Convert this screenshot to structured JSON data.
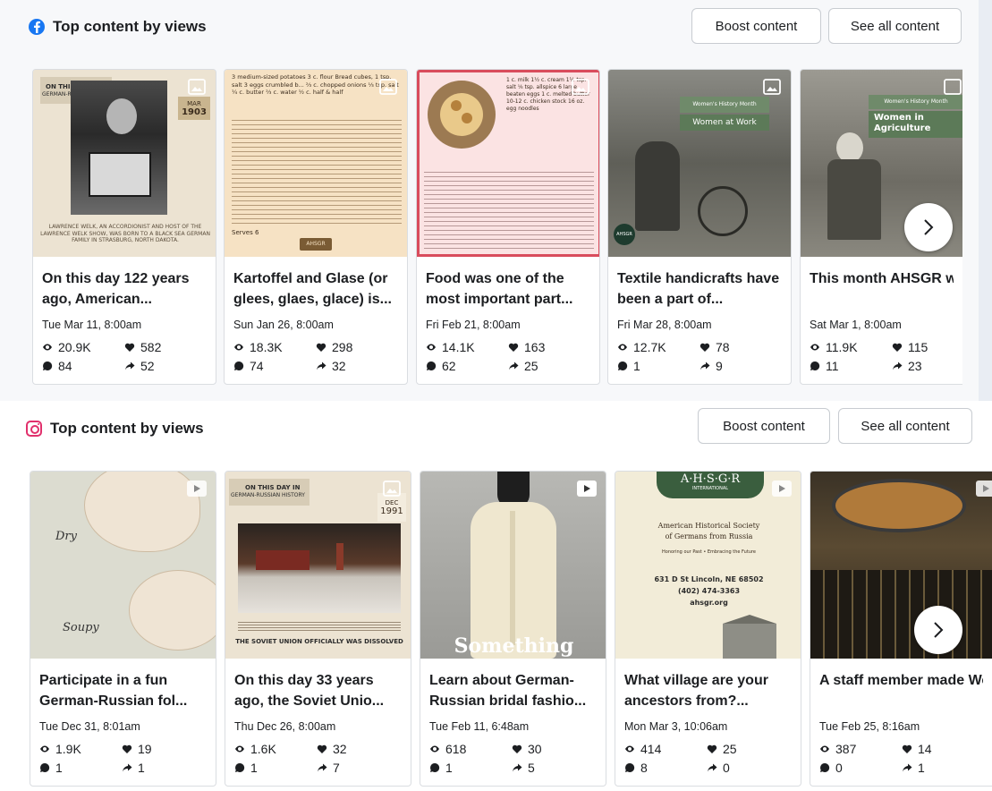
{
  "facebook": {
    "title": "Top content by views",
    "boost_label": "Boost content",
    "see_all_label": "See all content",
    "posts": [
      {
        "title": "On this day 122 years ago, American...",
        "date": "Tue Mar 11, 8:00am",
        "views": "20.9K",
        "likes": "582",
        "comments": "84",
        "shares": "52",
        "thumb_text": {
          "line1": "ON THIS DAY IN",
          "line2": "GERMAN-RUSSIAN HISTORY",
          "month": "MAR",
          "year": "1903",
          "caption": "LAWRENCE WELK, AN ACCORDIONIST AND HOST OF THE LAWRENCE WELK SHOW, WAS BORN TO A BLACK SEA GERMAN FAMILY IN STRASBURG, NORTH DAKOTA."
        }
      },
      {
        "title": "Kartoffel and Glase (or glees, glaes, glace) is...",
        "date": "Sun Jan 26, 8:00am",
        "views": "18.3K",
        "likes": "298",
        "comments": "74",
        "shares": "32",
        "thumb_text": {
          "recipe": "3 medium-sized potatoes  3 c. flour  Bread cubes, 1 tsp. salt  3 eggs  crumbled b... ⅔ c. chopped onions  ⅓ tsp. salt  ¼ c. butter  ⅔ c. water  ½ c. half & half",
          "serves": "Serves 6",
          "brand": "AHSGR"
        }
      },
      {
        "title": "Food was one of the most important part...",
        "date": "Fri Feb 21, 8:00am",
        "views": "14.1K",
        "likes": "163",
        "comments": "62",
        "shares": "25",
        "thumb_text": {
          "recipe": "1 c. milk  1½ c. cream  1½ tsp. salt  ⅛ tsp. allspice  6 large beaten eggs  1 c. melted butter  10-12 c. chicken stock  16 oz. egg noodles"
        }
      },
      {
        "title": "Textile handicrafts have been a part of...",
        "date": "Fri Mar 28, 8:00am",
        "views": "12.7K",
        "likes": "78",
        "comments": "1",
        "shares": "9",
        "thumb_text": {
          "tag": "Women's History Month",
          "heading": "Women at Work",
          "brand": "AHSGR"
        }
      },
      {
        "title": "This month AHSGR will be focusing on t...",
        "date": "Sat Mar 1, 8:00am",
        "views": "11.9K",
        "likes": "115",
        "comments": "11",
        "shares": "23",
        "thumb_text": {
          "tag": "Women's History Month",
          "heading": "Women in Agriculture"
        }
      }
    ]
  },
  "instagram": {
    "title": "Top content by views",
    "boost_label": "Boost content",
    "see_all_label": "See all content",
    "posts": [
      {
        "title": "Participate in a fun German-Russian fol...",
        "date": "Tue Dec 31, 8:01am",
        "views": "1.9K",
        "likes": "19",
        "comments": "1",
        "shares": "1",
        "thumb_text": {
          "word1": "Dry",
          "word2": "Soupy"
        }
      },
      {
        "title": "On this day 33 years ago, the Soviet Unio...",
        "date": "Thu Dec 26, 8:00am",
        "views": "1.6K",
        "likes": "32",
        "comments": "1",
        "shares": "7",
        "thumb_text": {
          "line1": "ON THIS DAY IN",
          "line2": "GERMAN-RUSSIAN HISTORY",
          "month": "DEC",
          "year": "1991",
          "caption": "THE SOVIET UNION OFFICIALLY WAS DISSOLVED"
        }
      },
      {
        "title": "Learn about German-Russian bridal fashio...",
        "date": "Tue Feb 11, 6:48am",
        "views": "618",
        "likes": "30",
        "comments": "1",
        "shares": "5",
        "thumb_text": {
          "overlay": "Something"
        }
      },
      {
        "title": "What village are your ancestors from?...",
        "date": "Mon Mar 3, 10:06am",
        "views": "414",
        "likes": "25",
        "comments": "8",
        "shares": "0",
        "thumb_text": {
          "logo": "A·H·S·G·R",
          "logo_sub": "INTERNATIONAL",
          "org1": "American Historical Society",
          "org2": "of Germans from Russia",
          "tagline": "Honoring our Past • Embracing the Future",
          "address": "631 D St Lincoln, NE 68502",
          "phone": "(402) 474-3363",
          "web": "ahsgr.org"
        }
      },
      {
        "title": "A staff member made Wedding Kuchen for...",
        "date": "Tue Feb 25, 8:16am",
        "views": "387",
        "likes": "14",
        "comments": "0",
        "shares": "1",
        "thumb_text": {}
      }
    ]
  },
  "colors": {
    "facebook_blue": "#1877f2",
    "instagram_pink": "#e1306c",
    "border": "#dadde1",
    "section_bg": "#f7f8fa"
  },
  "icons": {
    "views": "eye-icon",
    "likes": "heart-icon",
    "comments": "comment-icon",
    "shares": "share-icon",
    "next": "chevron-right-icon"
  }
}
